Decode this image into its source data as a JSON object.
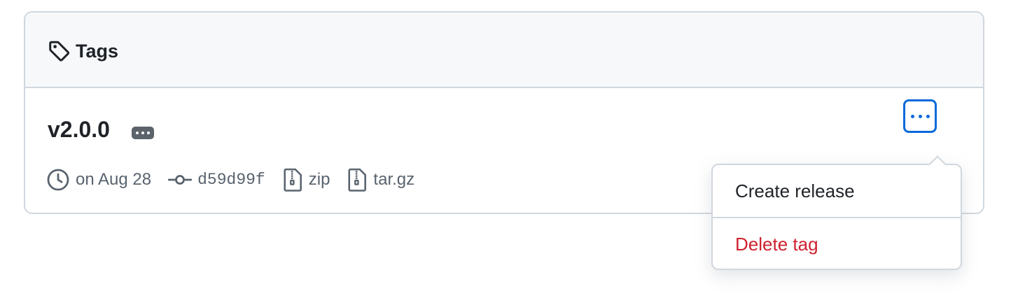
{
  "header": {
    "title": "Tags",
    "icon": "tag-icon"
  },
  "tag": {
    "name": "v2.0.0",
    "date": "on Aug 28",
    "commit": "d59d99f",
    "zip_label": "zip",
    "targz_label": "tar.gz"
  },
  "menu": {
    "create_label": "Create release",
    "delete_label": "Delete tag"
  },
  "colors": {
    "accent": "#0969da",
    "danger": "#cf222e",
    "border": "#d0d7de",
    "header_bg": "#f6f8fa",
    "muted_text": "#59636e"
  }
}
